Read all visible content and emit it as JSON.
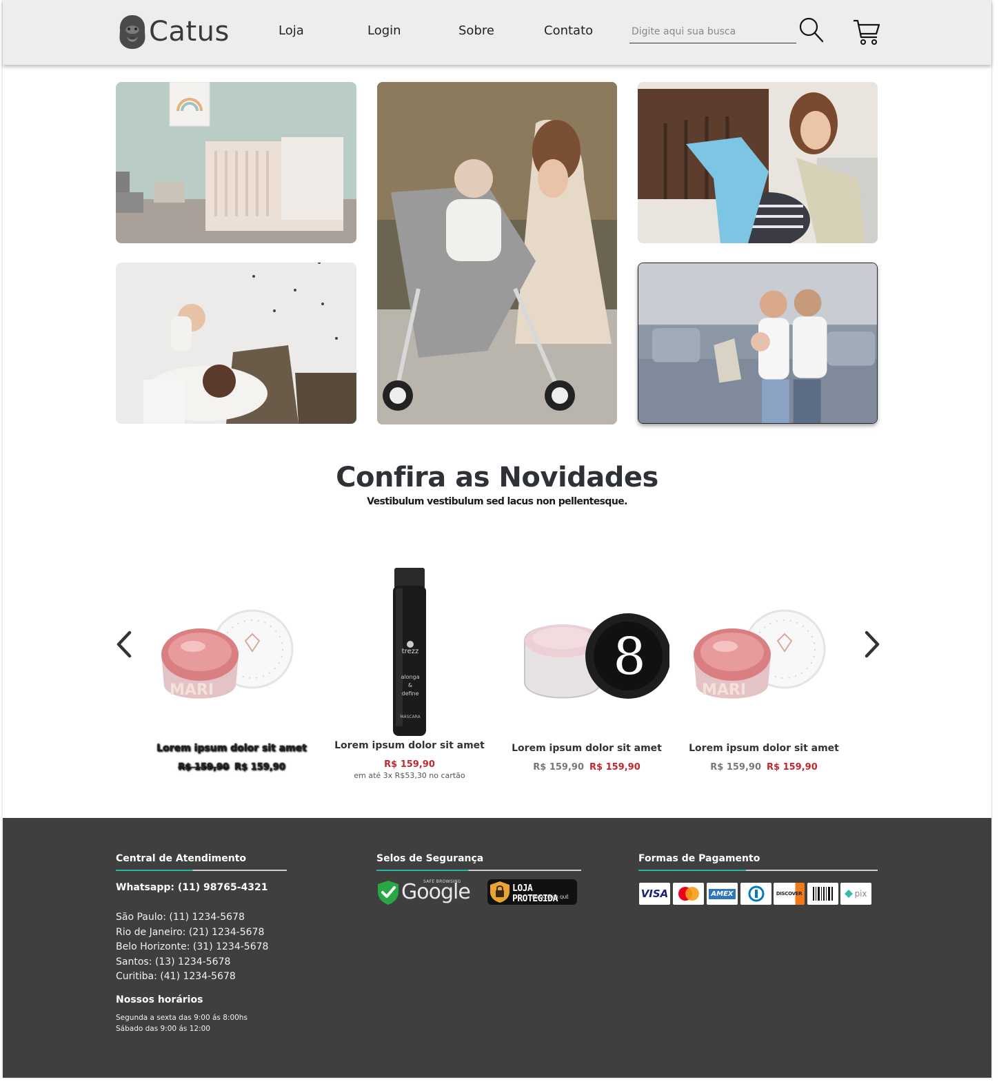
{
  "header": {
    "brand": "Catus",
    "nav": [
      "Loja",
      "Login",
      "Sobre",
      "Contato"
    ],
    "search_placeholder": "Digite aqui sua busca"
  },
  "news": {
    "title": "Confira as Novidades",
    "subtitle": "Vestibulum vestibulum sed lacus non pellentesque."
  },
  "products": [
    {
      "name": "Lorem ipsum dolor sit amet",
      "old_price": "R$ 159,90",
      "price": "R$ 159,90",
      "image": "pink-glitter-pot"
    },
    {
      "name": "Lorem ipsum dolor sit amet",
      "price": "R$ 159,90",
      "installments": "em até 3x R$53,30 no cartão",
      "image": "black-mascara"
    },
    {
      "name": "Lorem ipsum dolor sit amet",
      "old_price": "R$ 159,90",
      "price": "R$ 159,90",
      "image": "pink-cream-jar"
    },
    {
      "name": "Lorem ipsum dolor sit amet",
      "old_price": "R$ 159,90",
      "price": "R$ 159,90",
      "image": "pink-glitter-pot"
    }
  ],
  "footer": {
    "support": {
      "title": "Central de Atendimento",
      "whatsapp": "Whatsapp: (11) 98765-4321",
      "phones": [
        "São Paulo: (11) 1234-5678",
        "Rio de Janeiro: (21) 1234-5678",
        "Belo Horizonte: (31) 1234-5678",
        "Santos: (13) 1234-5678",
        "Curitiba: (41) 1234-5678"
      ],
      "hours_title": "Nossos horários",
      "hours": [
        "Segunda a sexta das 9:00 ás  8:00hs",
        "Sábado das 9:00 ás 12:00"
      ]
    },
    "security": {
      "title": "Selos de Segurança",
      "google_small": "SAFE BROWSING",
      "google": "Google",
      "loja_main": "LOJA PROTEGIDA",
      "loja_small": "SAIBA O POR QUÊ"
    },
    "payment": {
      "title": "Formas de Pagamento",
      "visa": "VISA",
      "amex": "AMEX",
      "discover": "DISCOVER",
      "pix": "pix"
    }
  },
  "colors": {
    "header_bg": "#ededed",
    "footer_bg": "#3f3f3f",
    "price_red": "#c0282d",
    "accent_teal": "#2bb3a3"
  }
}
